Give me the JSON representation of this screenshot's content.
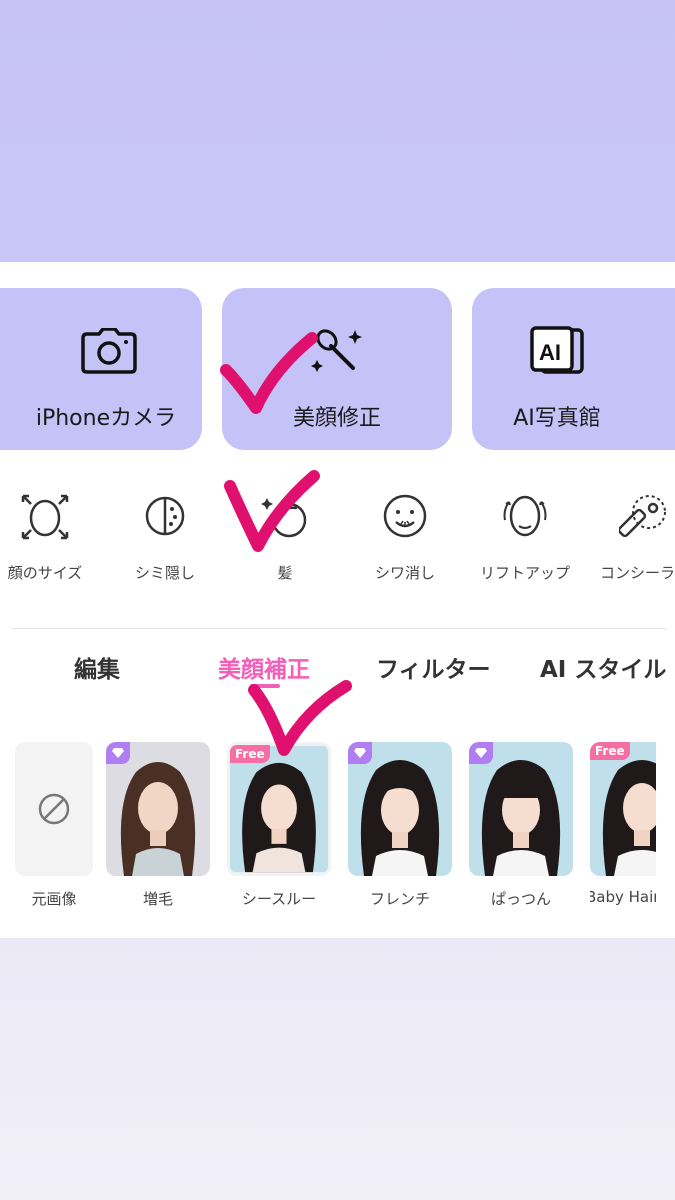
{
  "feature_cards": [
    {
      "label": "iPhoneカメラ",
      "icon": "camera-icon"
    },
    {
      "label": "美顔修正",
      "icon": "magic-wand-icon"
    },
    {
      "label": "AI写真館",
      "icon": "ai-photo-icon"
    }
  ],
  "tools": [
    {
      "label": "顔のサイズ",
      "icon": "face-size-icon"
    },
    {
      "label": "シミ隠し",
      "icon": "spot-conceal-icon"
    },
    {
      "label": "髪",
      "icon": "hair-icon"
    },
    {
      "label": "シワ消し",
      "icon": "wrinkle-remove-icon"
    },
    {
      "label": "リフトアップ",
      "icon": "lift-up-icon"
    },
    {
      "label": "コンシーラー",
      "icon": "concealer-icon"
    }
  ],
  "tabs": [
    {
      "label": "編集"
    },
    {
      "label": "美顔補正",
      "active": true
    },
    {
      "label": "フィルター"
    },
    {
      "label": "AI スタイル"
    }
  ],
  "presets": [
    {
      "label": "元画像",
      "badge": ""
    },
    {
      "label": "増毛",
      "badge": "vip"
    },
    {
      "label": "シースルー",
      "badge": "Free"
    },
    {
      "label": "フレンチ",
      "badge": "vip"
    },
    {
      "label": "ぱっつん",
      "badge": "vip"
    },
    {
      "label": "Baby Hair",
      "badge": "Free"
    }
  ],
  "colors": {
    "accent": "#f25fb8",
    "card_bg": "#c5c2f8",
    "top_band": "#c7c3f7",
    "check_marks": "#e0106e"
  }
}
